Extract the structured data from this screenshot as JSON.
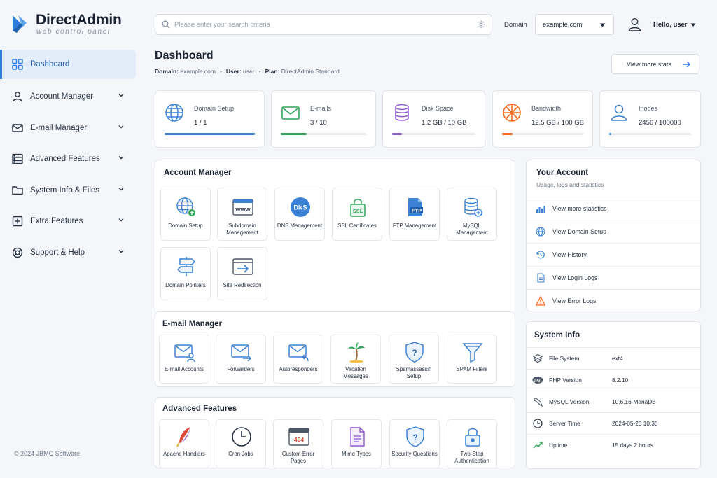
{
  "brand": {
    "name": "DirectAdmin",
    "tagline": "web control panel",
    "color": "#2f7be5"
  },
  "sidebar": {
    "items": [
      {
        "label": "Dashboard",
        "icon": "grid-icon",
        "active": true
      },
      {
        "label": "Account Manager",
        "icon": "user-icon"
      },
      {
        "label": "E-mail Manager",
        "icon": "mail-icon"
      },
      {
        "label": "Advanced Features",
        "icon": "server-icon"
      },
      {
        "label": "System Info & Files",
        "icon": "folder-icon"
      },
      {
        "label": "Extra Features",
        "icon": "plus-square-icon"
      },
      {
        "label": "Support & Help",
        "icon": "lifebuoy-icon"
      }
    ],
    "copyright": "© 2024 JBMC Software"
  },
  "header": {
    "search_placeholder": "Please enter your search criteria",
    "domain_label": "Domain",
    "domain_value": "example.com",
    "user_greeting": "Hello, user"
  },
  "page": {
    "title": "Dashboard",
    "domain_key": "Domain:",
    "domain_val": "example.com",
    "user_key": "User:",
    "user_val": "user",
    "plan_key": "Plan:",
    "plan_val": "DirectAdmin Standard",
    "view_stats": "View more stats"
  },
  "stats": [
    {
      "title": "Domain Setup",
      "value": "1 / 1",
      "icon": "globe-icon",
      "color": "#3b82d6",
      "usage": 1.0
    },
    {
      "title": "E-mails",
      "value": "3 / 10",
      "icon": "envelope-icon",
      "color": "#2fa55a",
      "usage": 0.3
    },
    {
      "title": "Disk Space",
      "value": "1.2 GB / 10 GB",
      "icon": "database-icon",
      "color": "#8e5bd0",
      "usage": 0.12
    },
    {
      "title": "Bandwidth",
      "value": "12.5 GB / 100 GB",
      "icon": "network-globe-icon",
      "color": "#f26b21",
      "usage": 0.125
    },
    {
      "title": "Inodes",
      "value": "2456 / 100000",
      "icon": "person-icon",
      "color": "#3b82d6",
      "usage": 0.025
    }
  ],
  "account_manager": {
    "title": "Account Manager",
    "tiles": [
      {
        "label": "Domain Setup",
        "icon": "globe-add-icon"
      },
      {
        "label": "Subdomain Management",
        "icon": "www-icon"
      },
      {
        "label": "DNS Management",
        "icon": "dns-icon"
      },
      {
        "label": "SSL Certificates",
        "icon": "ssl-icon"
      },
      {
        "label": "FTP Management",
        "icon": "ftp-icon"
      },
      {
        "label": "MySQL Management",
        "icon": "mysql-icon"
      },
      {
        "label": "Domain Pointers",
        "icon": "signpost-icon"
      },
      {
        "label": "Site Redirection",
        "icon": "redirect-icon"
      }
    ]
  },
  "email_manager": {
    "title": "E-mail Manager",
    "tiles": [
      {
        "label": "E-mail Accounts",
        "icon": "mail-user-icon"
      },
      {
        "label": "Forwarders",
        "icon": "mail-forward-icon"
      },
      {
        "label": "Autoresponders",
        "icon": "mail-reply-icon"
      },
      {
        "label": "Vacation Messages",
        "icon": "palm-tree-icon"
      },
      {
        "label": "Spamassassin Setup",
        "icon": "shield-question-icon"
      },
      {
        "label": "SPAM Filters",
        "icon": "funnel-icon"
      }
    ]
  },
  "advanced_features": {
    "title": "Advanced Features",
    "tiles": [
      {
        "label": "Apache Handlers",
        "icon": "feather-icon"
      },
      {
        "label": "Cron Jobs",
        "icon": "clock-icon"
      },
      {
        "label": "Custom Error Pages",
        "icon": "error-404-icon"
      },
      {
        "label": "Mime Types",
        "icon": "document-icon"
      },
      {
        "label": "Security Questions",
        "icon": "shield-question-icon"
      },
      {
        "label": "Two-Step Authentication",
        "icon": "lock-icon"
      }
    ]
  },
  "your_account": {
    "title": "Your Account",
    "subtitle": "Usage, logs and statistics",
    "links": [
      {
        "label": "View more statistics",
        "icon": "bar-chart-icon"
      },
      {
        "label": "View Domain Setup",
        "icon": "globe-icon"
      },
      {
        "label": "View History",
        "icon": "history-icon"
      },
      {
        "label": "View Login Logs",
        "icon": "file-icon"
      },
      {
        "label": "View Error Logs",
        "icon": "warning-icon"
      }
    ]
  },
  "system_info": {
    "title": "System Info",
    "rows": [
      {
        "key": "File System",
        "value": "ext4",
        "icon": "layers-icon"
      },
      {
        "key": "PHP Version",
        "value": "8.2.10",
        "icon": "php-icon"
      },
      {
        "key": "MySQL Version",
        "value": "10.6.16-MariaDB",
        "icon": "dolphin-icon"
      },
      {
        "key": "Server Time",
        "value": "2024-05-20 10:30",
        "icon": "clock-icon"
      },
      {
        "key": "Uptime",
        "value": "15 days 2 hours",
        "icon": "trend-icon"
      }
    ]
  }
}
